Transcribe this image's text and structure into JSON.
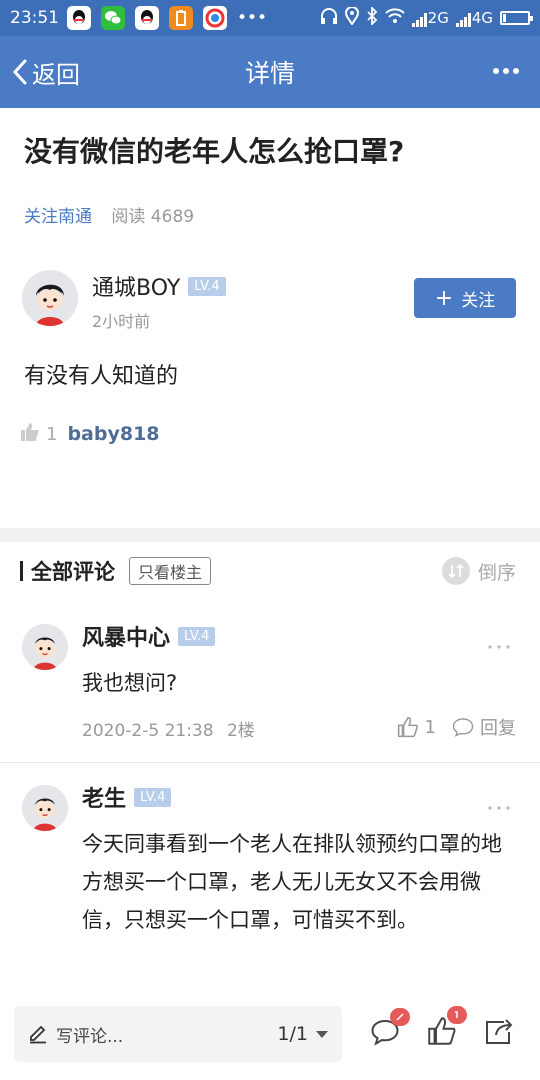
{
  "status_bar": {
    "time": "23:51",
    "network_2g": "2G",
    "network_4g": "4G",
    "more_dots": "•••",
    "battery_level": 0.1
  },
  "nav": {
    "back_label": "返回",
    "title": "详情"
  },
  "post": {
    "title": "没有微信的老年人怎么抢口罩?",
    "follow_link": "关注南通",
    "reads": "阅读 4689",
    "author": {
      "name": "通城BOY",
      "level": "LV.4",
      "time": "2小时前"
    },
    "follow_button": "关注",
    "body": "有没有人知道的",
    "like_count": "1",
    "liker": "baby818"
  },
  "comments_section": {
    "title": "全部评论",
    "only_host": "只看楼主",
    "sort_label": "倒序"
  },
  "comments": [
    {
      "name": "风暴中心",
      "level": "LV.4",
      "text": "我也想问?",
      "time": "2020-2-5 21:38",
      "floor": "2楼",
      "likes": "1",
      "reply": "回复"
    },
    {
      "name": "老生",
      "level": "LV.4",
      "text": "今天同事看到一个老人在排队领预约口罩的地方想买一个口罩，老人无儿无女又不会用微信，只想买一个口罩，可惜买不到。"
    }
  ],
  "bottom_bar": {
    "comment_placeholder": "写评论...",
    "page": "1/1"
  },
  "colors": {
    "navbar": "#4a7bc4",
    "status_bar": "#3d6fb8",
    "accent": "#4a7bc4",
    "level_badge": "#b8cdea",
    "notification_badge": "#e55b5b"
  }
}
